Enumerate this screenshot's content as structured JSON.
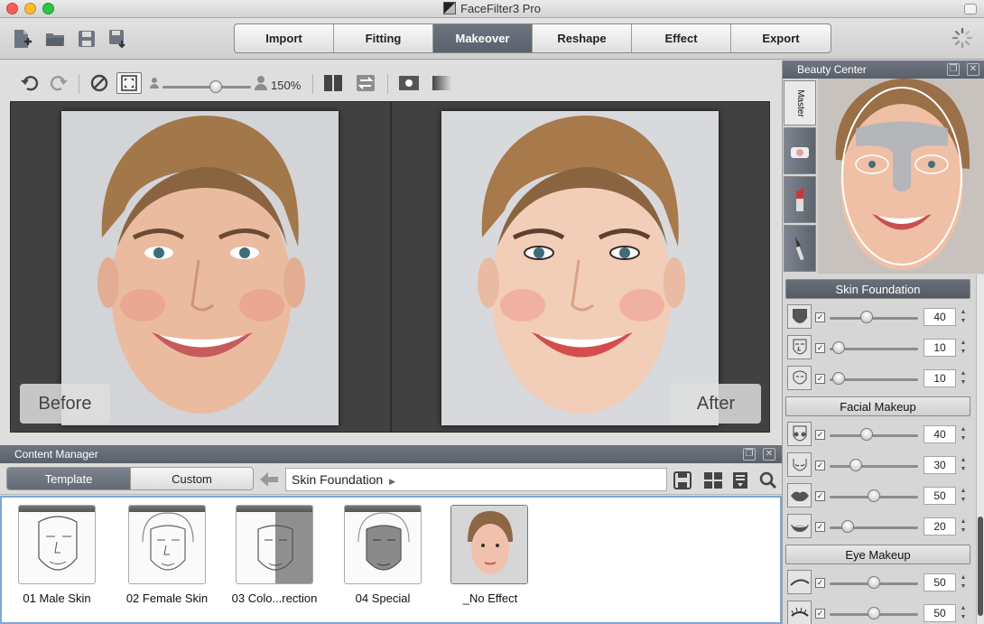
{
  "window": {
    "title": "FaceFilter3 Pro"
  },
  "toolbar": {
    "file_icons": [
      "new-document-icon",
      "open-folder-icon",
      "save-icon",
      "export-save-icon"
    ],
    "tabs": [
      {
        "label": "Import",
        "active": false
      },
      {
        "label": "Fitting",
        "active": false
      },
      {
        "label": "Makeover",
        "active": true
      },
      {
        "label": "Reshape",
        "active": false
      },
      {
        "label": "Effect",
        "active": false
      },
      {
        "label": "Export",
        "active": false
      }
    ]
  },
  "viewer": {
    "zoom_label": "150%",
    "zoom_fraction": 0.6,
    "before_label": "Before",
    "after_label": "After"
  },
  "content_manager": {
    "title": "Content Manager",
    "tabs": [
      {
        "label": "Template",
        "active": true
      },
      {
        "label": "Custom",
        "active": false
      }
    ],
    "path": "Skin Foundation",
    "items": [
      {
        "label": "01 Male Skin"
      },
      {
        "label": "02 Female Skin"
      },
      {
        "label": "03 Colo...rection"
      },
      {
        "label": "04 Special"
      },
      {
        "label": "_No Effect"
      }
    ]
  },
  "beauty_center": {
    "title": "Beauty Center",
    "master_label": "Master",
    "sections": [
      {
        "label": "Skin Foundation",
        "style": "dark",
        "rows": [
          {
            "icon": "face-shape-icon",
            "value": "40",
            "fraction": 0.42
          },
          {
            "icon": "face-mask-icon",
            "value": "10",
            "fraction": 0.1
          },
          {
            "icon": "face-outline-icon",
            "value": "10",
            "fraction": 0.1
          }
        ]
      },
      {
        "label": "Facial Makeup",
        "style": "light",
        "rows": [
          {
            "icon": "blush-face-icon",
            "value": "40",
            "fraction": 0.42
          },
          {
            "icon": "cheek-contour-icon",
            "value": "30",
            "fraction": 0.3
          },
          {
            "icon": "lips-icon",
            "value": "50",
            "fraction": 0.5
          },
          {
            "icon": "smile-lips-icon",
            "value": "20",
            "fraction": 0.2
          }
        ]
      },
      {
        "label": "Eye Makeup",
        "style": "light",
        "rows": [
          {
            "icon": "eyebrow-icon",
            "value": "50",
            "fraction": 0.5
          },
          {
            "icon": "eyelash-icon",
            "value": "50",
            "fraction": 0.5
          }
        ]
      }
    ]
  },
  "colors": {
    "accent": "#5d636d",
    "selection": "#7fa7d6"
  }
}
